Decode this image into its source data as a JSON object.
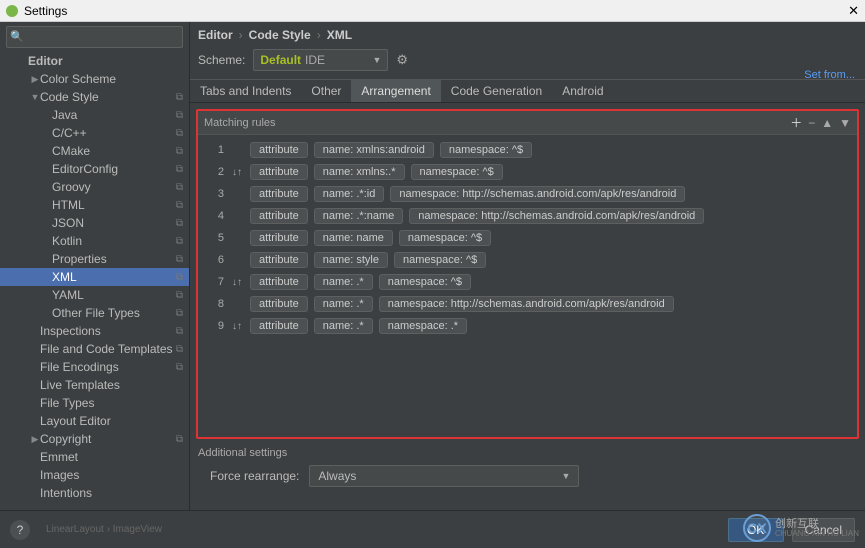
{
  "window": {
    "title": "Settings"
  },
  "search": {
    "placeholder": ""
  },
  "sidebar": {
    "items": [
      {
        "label": "Editor",
        "level": "l0",
        "arrow": "",
        "copy": false,
        "sel": false,
        "header": true
      },
      {
        "label": "Color Scheme",
        "level": "l1",
        "arrow": "▶",
        "copy": false,
        "sel": false
      },
      {
        "label": "Code Style",
        "level": "l1",
        "arrow": "▼",
        "copy": true,
        "sel": false
      },
      {
        "label": "Java",
        "level": "l2",
        "arrow": "",
        "copy": true,
        "sel": false
      },
      {
        "label": "C/C++",
        "level": "l2",
        "arrow": "",
        "copy": true,
        "sel": false
      },
      {
        "label": "CMake",
        "level": "l2",
        "arrow": "",
        "copy": true,
        "sel": false
      },
      {
        "label": "EditorConfig",
        "level": "l2",
        "arrow": "",
        "copy": true,
        "sel": false
      },
      {
        "label": "Groovy",
        "level": "l2",
        "arrow": "",
        "copy": true,
        "sel": false
      },
      {
        "label": "HTML",
        "level": "l2",
        "arrow": "",
        "copy": true,
        "sel": false
      },
      {
        "label": "JSON",
        "level": "l2",
        "arrow": "",
        "copy": true,
        "sel": false
      },
      {
        "label": "Kotlin",
        "level": "l2",
        "arrow": "",
        "copy": true,
        "sel": false
      },
      {
        "label": "Properties",
        "level": "l2",
        "arrow": "",
        "copy": true,
        "sel": false
      },
      {
        "label": "XML",
        "level": "l2",
        "arrow": "",
        "copy": true,
        "sel": true
      },
      {
        "label": "YAML",
        "level": "l2",
        "arrow": "",
        "copy": true,
        "sel": false
      },
      {
        "label": "Other File Types",
        "level": "l2",
        "arrow": "",
        "copy": true,
        "sel": false
      },
      {
        "label": "Inspections",
        "level": "l1",
        "arrow": "",
        "copy": true,
        "sel": false
      },
      {
        "label": "File and Code Templates",
        "level": "l1",
        "arrow": "",
        "copy": true,
        "sel": false
      },
      {
        "label": "File Encodings",
        "level": "l1",
        "arrow": "",
        "copy": true,
        "sel": false
      },
      {
        "label": "Live Templates",
        "level": "l1",
        "arrow": "",
        "copy": false,
        "sel": false
      },
      {
        "label": "File Types",
        "level": "l1",
        "arrow": "",
        "copy": false,
        "sel": false
      },
      {
        "label": "Layout Editor",
        "level": "l1",
        "arrow": "",
        "copy": false,
        "sel": false
      },
      {
        "label": "Copyright",
        "level": "l1",
        "arrow": "▶",
        "copy": true,
        "sel": false
      },
      {
        "label": "Emmet",
        "level": "l1",
        "arrow": "",
        "copy": false,
        "sel": false
      },
      {
        "label": "Images",
        "level": "l1",
        "arrow": "",
        "copy": false,
        "sel": false
      },
      {
        "label": "Intentions",
        "level": "l1",
        "arrow": "",
        "copy": false,
        "sel": false
      }
    ]
  },
  "breadcrumb": [
    "Editor",
    "Code Style",
    "XML"
  ],
  "scheme": {
    "label": "Scheme:",
    "value": "Default",
    "ide": "IDE",
    "setfrom": "Set from..."
  },
  "tabs": [
    {
      "label": "Tabs and Indents",
      "active": false
    },
    {
      "label": "Other",
      "active": false
    },
    {
      "label": "Arrangement",
      "active": true
    },
    {
      "label": "Code Generation",
      "active": false
    },
    {
      "label": "Android",
      "active": false
    }
  ],
  "rules": {
    "header": "Matching rules",
    "items": [
      {
        "n": "1",
        "sort": "",
        "type": "attribute",
        "name": "name: xmlns:android",
        "ns": "namespace: ^$"
      },
      {
        "n": "2",
        "sort": "↓↑",
        "type": "attribute",
        "name": "name: xmlns:.*",
        "ns": "namespace: ^$"
      },
      {
        "n": "3",
        "sort": "",
        "type": "attribute",
        "name": "name: .*:id",
        "ns": "namespace: http://schemas.android.com/apk/res/android"
      },
      {
        "n": "4",
        "sort": "",
        "type": "attribute",
        "name": "name: .*:name",
        "ns": "namespace: http://schemas.android.com/apk/res/android"
      },
      {
        "n": "5",
        "sort": "",
        "type": "attribute",
        "name": "name: name",
        "ns": "namespace: ^$"
      },
      {
        "n": "6",
        "sort": "",
        "type": "attribute",
        "name": "name: style",
        "ns": "namespace: ^$"
      },
      {
        "n": "7",
        "sort": "↓↑",
        "type": "attribute",
        "name": "name: .*",
        "ns": "namespace: ^$"
      },
      {
        "n": "8",
        "sort": "",
        "type": "attribute",
        "name": "name: .*",
        "ns": "namespace: http://schemas.android.com/apk/res/android"
      },
      {
        "n": "9",
        "sort": "↓↑",
        "type": "attribute",
        "name": "name: .*",
        "ns": "namespace: .*"
      }
    ]
  },
  "additional": {
    "header": "Additional settings",
    "force_label": "Force rearrange:",
    "force_value": "Always"
  },
  "buttons": {
    "ok": "OK",
    "cancel": "Cancel"
  },
  "footer_path": "LinearLayout  ›  ImageView",
  "watermark": {
    "cn": "创新互联",
    "en": "CHUANG XIN HU LIAN"
  }
}
